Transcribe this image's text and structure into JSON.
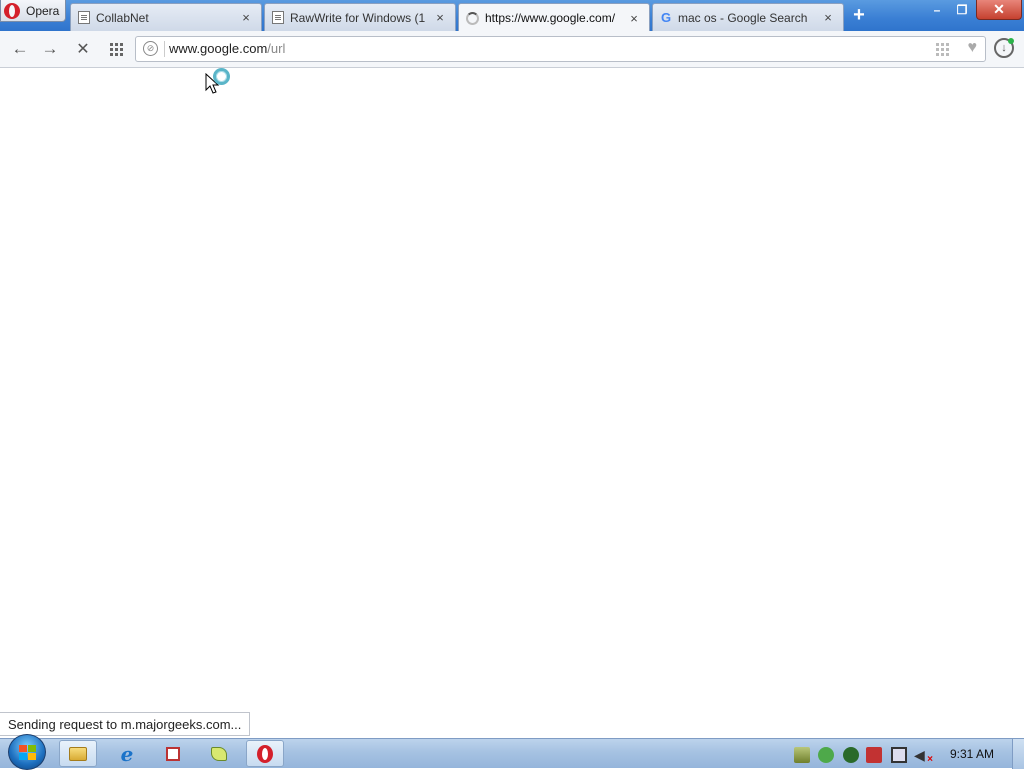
{
  "browser": {
    "menu_label": "Opera",
    "tabs": [
      {
        "label": "CollabNet",
        "icon": "page-icon",
        "active": false
      },
      {
        "label": "RawWrite for Windows (1 ",
        "icon": "page-icon",
        "active": false
      },
      {
        "label": "https://www.google.com/",
        "icon": "loading-spinner-icon",
        "active": true
      },
      {
        "label": "mac os - Google Search",
        "icon": "google-icon",
        "active": false
      }
    ],
    "close_glyph": "×",
    "new_tab_glyph": "+"
  },
  "window_controls": {
    "minimize": "–",
    "maximize": "❐",
    "close": "✕"
  },
  "toolbar": {
    "back_glyph": "←",
    "forward_glyph": "→",
    "stop_glyph": "✕",
    "address_host": "www.google.com",
    "address_path": "/url"
  },
  "status": {
    "text": "Sending request to m.majorgeeks.com..."
  },
  "taskbar": {
    "clock": "9:31 AM",
    "pinned": [
      "windows-explorer",
      "internet-explorer",
      "app",
      "app",
      "opera"
    ]
  }
}
